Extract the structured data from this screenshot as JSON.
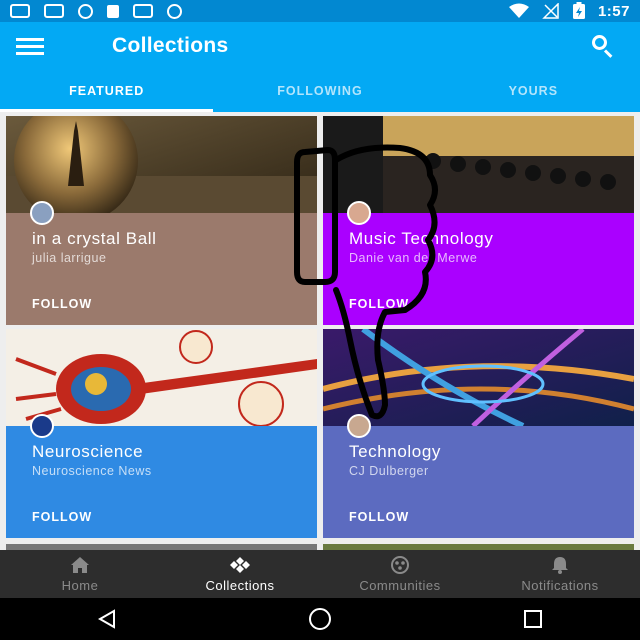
{
  "status_bar": {
    "time": "1:57",
    "icons_left": [
      "image-icon",
      "message-icon",
      "data-saver-icon",
      "lock-icon",
      "fax-icon",
      "android-icon"
    ],
    "icons_right": [
      "wifi-icon",
      "no-signal-icon",
      "battery-charging-icon"
    ]
  },
  "app_bar": {
    "title": "Collections",
    "menu_icon": "hamburger-menu-icon",
    "search_icon": "search-icon"
  },
  "tabs": [
    {
      "label": "FEATURED",
      "active": true
    },
    {
      "label": "FOLLOWING",
      "active": false
    },
    {
      "label": "YOURS",
      "active": false
    }
  ],
  "cards": [
    {
      "title": "in a crystal Ball",
      "author": "julia larrigue",
      "follow": "FOLLOW",
      "color": "#9b7a6c"
    },
    {
      "title": "Music Technology",
      "author": "Danie van der Merwe",
      "follow": "FOLLOW",
      "color": "#aa00ff"
    },
    {
      "title": "Neuroscience",
      "author": "Neuroscience News",
      "follow": "FOLLOW",
      "color": "#2f8ae3"
    },
    {
      "title": "Technology",
      "author": "CJ Dulberger",
      "follow": "FOLLOW",
      "color": "#5c6bc0"
    }
  ],
  "bottom_nav": [
    {
      "label": "Home",
      "icon": "home-icon",
      "active": false
    },
    {
      "label": "Collections",
      "icon": "collections-icon",
      "active": true
    },
    {
      "label": "Communities",
      "icon": "communities-icon",
      "active": false
    },
    {
      "label": "Notifications",
      "icon": "bell-icon",
      "active": false
    }
  ],
  "system_nav": [
    "back-icon",
    "home-circle-icon",
    "recents-icon"
  ],
  "colors": {
    "status_bar": "#0288d1",
    "app_bar": "#03a9f4",
    "bottom_nav": "#2d2d2d"
  }
}
